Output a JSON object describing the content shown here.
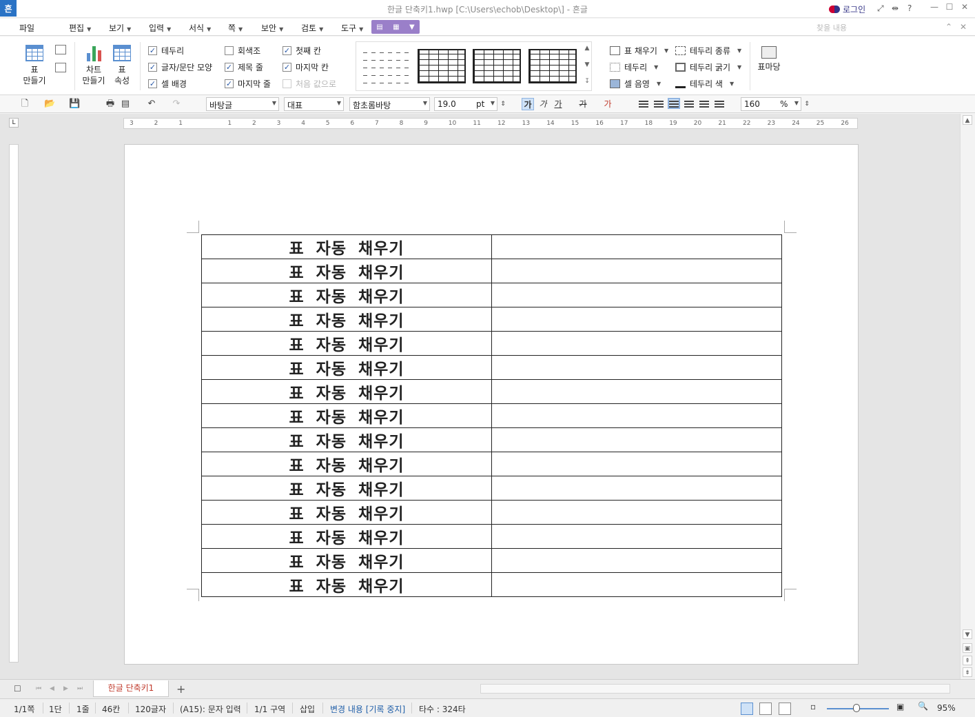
{
  "window": {
    "app_logo": "흔",
    "title": "한글 단축키1.hwp [C:\\Users\\echob\\Desktop\\] - 흔글",
    "login_label": "로그인"
  },
  "menubar": {
    "items": [
      "파일",
      "편집",
      "보기",
      "입력",
      "서식",
      "쪽",
      "보안",
      "검토",
      "도구"
    ],
    "search_placeholder": "찾을 내용"
  },
  "ribbon": {
    "table_create": "표\n만들기",
    "chart_create": "차트\n만들기",
    "table_props": "표\n속성",
    "checks_col1": [
      {
        "label": "테두리",
        "checked": true
      },
      {
        "label": "글자/문단 모양",
        "checked": true
      },
      {
        "label": "셀 배경",
        "checked": true
      }
    ],
    "checks_col2": [
      {
        "label": "회색조",
        "checked": false
      },
      {
        "label": "제목 줄",
        "checked": true
      },
      {
        "label": "마지막 줄",
        "checked": true
      }
    ],
    "checks_col3": [
      {
        "label": "첫째 칸",
        "checked": true
      },
      {
        "label": "마지막 칸",
        "checked": true
      },
      {
        "label": "처음 값으로",
        "checked": false,
        "disabled": true
      }
    ],
    "cmds_col1": [
      "표 채우기",
      "테두리",
      "셀 음영"
    ],
    "cmds_col2": [
      "테두리 종류",
      "테두리 굵기",
      "테두리 색"
    ],
    "table_pattern": "표마당"
  },
  "format": {
    "style": "바탕글",
    "language": "대표",
    "font": "함초롬바탕",
    "size": "19.0",
    "size_unit": "pt",
    "zoom": "160",
    "zoom_unit": "%",
    "bold_label": "가",
    "italic_label": "가",
    "underline_label": "가",
    "strike_label": "가",
    "color_label": "가"
  },
  "ruler": {
    "h_ticks": [
      "3",
      "2",
      "1",
      "",
      "1",
      "2",
      "3",
      "4",
      "5",
      "6",
      "7",
      "8",
      "9",
      "10",
      "11",
      "12",
      "13",
      "14",
      "15",
      "16",
      "17",
      "18",
      "19",
      "20",
      "21",
      "22",
      "23",
      "24",
      "25",
      "26"
    ]
  },
  "document": {
    "rows": [
      {
        "c1": "표 자동 채우기",
        "c2": ""
      },
      {
        "c1": "표 자동 채우기",
        "c2": ""
      },
      {
        "c1": "표 자동 채우기",
        "c2": ""
      },
      {
        "c1": "표 자동 채우기",
        "c2": ""
      },
      {
        "c1": "표 자동 채우기",
        "c2": ""
      },
      {
        "c1": "표 자동 채우기",
        "c2": ""
      },
      {
        "c1": "표 자동 채우기",
        "c2": ""
      },
      {
        "c1": "표 자동 채우기",
        "c2": ""
      },
      {
        "c1": "표 자동 채우기",
        "c2": ""
      },
      {
        "c1": "표 자동 채우기",
        "c2": ""
      },
      {
        "c1": "표 자동 채우기",
        "c2": ""
      },
      {
        "c1": "표 자동 채우기",
        "c2": ""
      },
      {
        "c1": "표 자동 채우기",
        "c2": ""
      },
      {
        "c1": "표 자동 채우기",
        "c2": ""
      },
      {
        "c1": "표 자동 채우기",
        "c2": ""
      }
    ]
  },
  "tabs": {
    "doc_tab": "한글 단축키1",
    "add": "+"
  },
  "status": {
    "page": "1/1쪽",
    "column": "1단",
    "line": "1줄",
    "col": "46칸",
    "chars": "120글자",
    "cell_mode": "(A15): 문자 입력",
    "section": "1/1 구역",
    "insert": "삽입",
    "track": "변경 내용 [기록 중지]",
    "typing": "타수 : 324타",
    "zoom": "95%"
  },
  "colors": {
    "accent": "#2a73c5",
    "tab_purple": "#9a7fc9",
    "tab_text_red": "#c0392b"
  }
}
